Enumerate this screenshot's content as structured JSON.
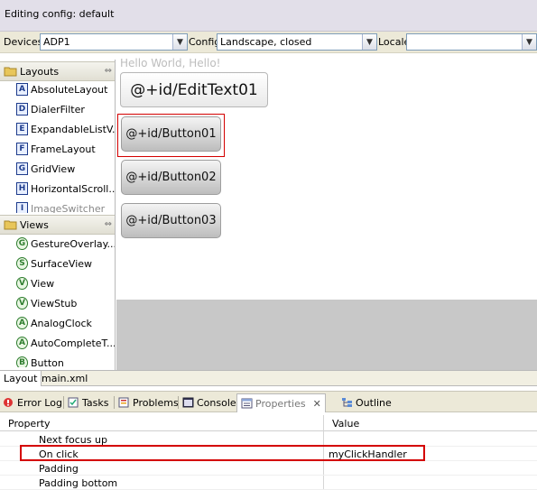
{
  "header": {
    "title": "Editing config:  default"
  },
  "device_bar": {
    "devices_label": "Devices",
    "devices_value": "ADP1",
    "config_label": "Config",
    "config_value": "Landscape, closed",
    "locale_label": "Locale",
    "locale_value": ""
  },
  "palette": {
    "layouts_label": "Layouts",
    "layouts": [
      {
        "icon": "A",
        "label": "AbsoluteLayout"
      },
      {
        "icon": "D",
        "label": "DialerFilter"
      },
      {
        "icon": "E",
        "label": "ExpandableListV..."
      },
      {
        "icon": "F",
        "label": "FrameLayout"
      },
      {
        "icon": "G",
        "label": "GridView"
      },
      {
        "icon": "H",
        "label": "HorizontalScroll..."
      },
      {
        "icon": "I",
        "label": "ImageSwitcher"
      }
    ],
    "views_label": "Views",
    "views": [
      {
        "icon": "G",
        "label": "GestureOverlay..."
      },
      {
        "icon": "S",
        "label": "SurfaceView"
      },
      {
        "icon": "V",
        "label": "View"
      },
      {
        "icon": "V",
        "label": "ViewStub"
      },
      {
        "icon": "A",
        "label": "AnalogClock"
      },
      {
        "icon": "A",
        "label": "AutoCompleteT..."
      },
      {
        "icon": "B",
        "label": "Button"
      }
    ]
  },
  "canvas": {
    "hello_text": "Hello World, Hello!",
    "edittext": "@+id/EditText01",
    "buttons": [
      "@+id/Button01",
      "@+id/Button02",
      "@+id/Button03"
    ]
  },
  "editor_tabs": [
    "Layout",
    "main.xml"
  ],
  "views": {
    "tabs": [
      "Error Log",
      "Tasks",
      "Problems",
      "Console",
      "Properties",
      "Outline"
    ],
    "close_glyph": "✕"
  },
  "properties": {
    "col_property": "Property",
    "col_value": "Value",
    "rows": [
      {
        "name": "Next focus up",
        "value": ""
      },
      {
        "name": "On click",
        "value": "myClickHandler"
      },
      {
        "name": "Padding",
        "value": ""
      },
      {
        "name": "Padding bottom",
        "value": ""
      }
    ]
  },
  "colors": {
    "highlight": "#d40000",
    "canvas_gray": "#c8c8c8"
  }
}
